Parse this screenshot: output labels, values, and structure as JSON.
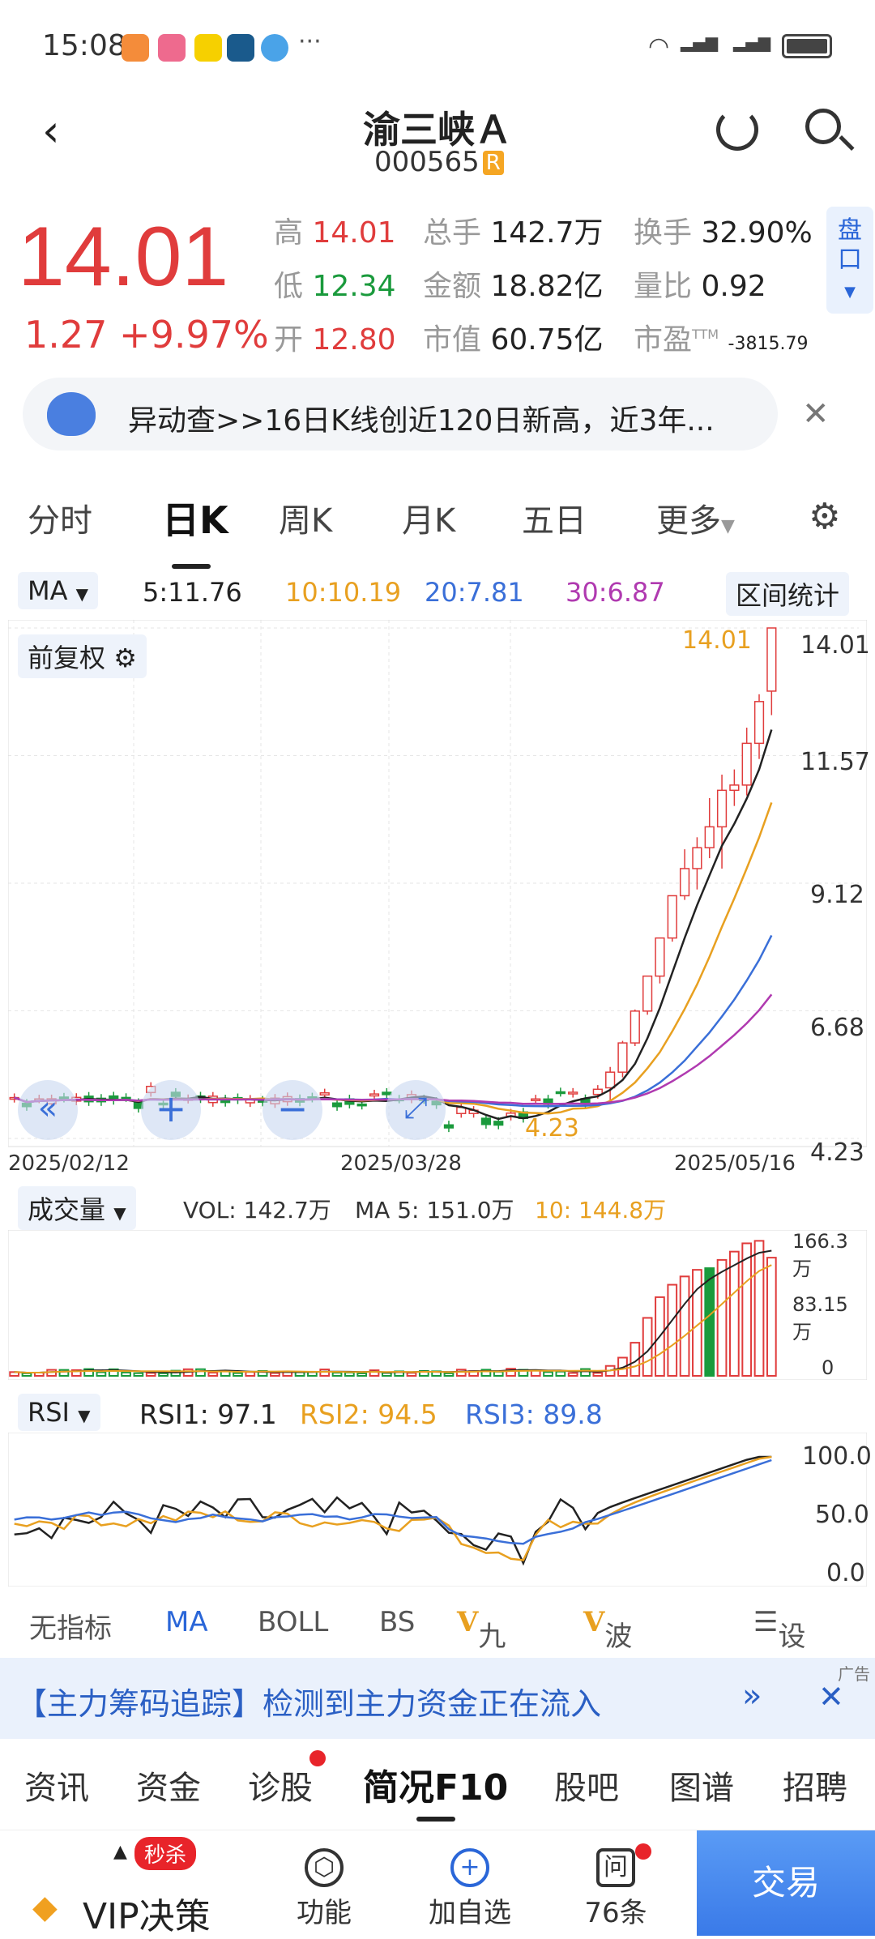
{
  "status_bar": {
    "time": "15:08",
    "network": "4G 4G"
  },
  "header": {
    "title": "渝三峡Ａ",
    "code": "000565",
    "badge": "R"
  },
  "quote": {
    "price": "14.01",
    "change": "1.27 +9.97%",
    "high_label": "高",
    "high": "14.01",
    "low_label": "低",
    "low": "12.34",
    "open_label": "开",
    "open": "12.80",
    "volume_label": "总手",
    "volume": "142.7万",
    "amount_label": "金额",
    "amount": "18.82亿",
    "mktcap_label": "市值",
    "mktcap": "60.75亿",
    "turnover_label": "换手",
    "turnover": "32.90%",
    "volratio_label": "量比",
    "volratio": "0.92",
    "pe_label": "市盈",
    "pe_sup": "TTM",
    "pe": "-3815.79",
    "pankou": "盘口"
  },
  "alert": {
    "text": "异动查>>16日K线创近120日新高，近3年..."
  },
  "tabs": [
    "分时",
    "日K",
    "周K",
    "月K",
    "五日",
    "更多"
  ],
  "active_tab": "日K",
  "ma_line": {
    "selector": "MA",
    "ma5": "5:11.76",
    "ma10": "10:10.19",
    "ma20": "20:7.81",
    "ma30": "30:6.87",
    "range_stat": "区间统计",
    "colors": {
      "ma5": "#222222",
      "ma10": "#e8a020",
      "ma20": "#3a6fd8",
      "ma30": "#b03ab0"
    }
  },
  "kchart": {
    "fuquan": "前复权",
    "max_label": "14.01",
    "min_label": "4.23",
    "y_ticks": [
      "14.01",
      "11.57",
      "9.12",
      "6.68",
      "4.23"
    ],
    "dates": [
      "2025/02/12",
      "2025/03/28",
      "2025/05/16"
    ]
  },
  "volume": {
    "selector": "成交量",
    "vol": "VOL: 142.7万",
    "ma5": "MA 5: 151.0万",
    "ma10": "10: 144.8万",
    "y_ticks": [
      "166.3万",
      "83.15万",
      "0"
    ]
  },
  "rsi": {
    "selector": "RSI",
    "rsi1": "RSI1: 97.1",
    "rsi2": "RSI2: 94.5",
    "rsi3": "RSI3: 89.8",
    "y_ticks": [
      "100.0",
      "50.0",
      "0.0"
    ]
  },
  "indicators": [
    "无指标",
    "MA",
    "BOLL",
    "BS",
    "九转",
    "波段王",
    "设置"
  ],
  "ad": {
    "text": "【主力筹码追踪】检测到主力资金正在流入",
    "tag": "广告"
  },
  "f10_tabs": [
    "资讯",
    "资金",
    "诊股",
    "简况F10",
    "股吧",
    "图谱",
    "招聘"
  ],
  "bottom_bar": {
    "vip": "VIP决策",
    "miaosha": "秒杀",
    "func": "功能",
    "add": "加自选",
    "ask": "76条",
    "trade": "交易"
  },
  "chart_data": {
    "type": "candlestick",
    "ohlc_recent": [
      [
        5.2,
        5.6,
        4.9,
        5.5
      ],
      [
        5.5,
        6.1,
        5.4,
        6.06
      ],
      [
        6.06,
        6.7,
        6.0,
        6.67
      ],
      [
        6.67,
        7.34,
        6.6,
        7.34
      ],
      [
        7.34,
        8.07,
        7.2,
        8.07
      ],
      [
        8.07,
        8.88,
        8.0,
        8.88
      ],
      [
        8.88,
        9.77,
        8.8,
        9.4
      ],
      [
        9.4,
        10.0,
        9.0,
        9.8
      ],
      [
        9.8,
        10.75,
        9.6,
        10.2
      ],
      [
        10.2,
        11.2,
        9.4,
        10.9
      ],
      [
        10.9,
        11.3,
        10.6,
        11.0
      ],
      [
        11.0,
        12.1,
        10.8,
        11.8
      ],
      [
        11.8,
        12.74,
        11.5,
        12.6
      ],
      [
        12.8,
        14.01,
        12.34,
        14.01
      ]
    ],
    "ma_final": {
      "MA5": 11.76,
      "MA10": 10.19,
      "MA20": 7.81,
      "MA30": 6.87
    },
    "price_range": [
      4.23,
      14.01
    ]
  }
}
